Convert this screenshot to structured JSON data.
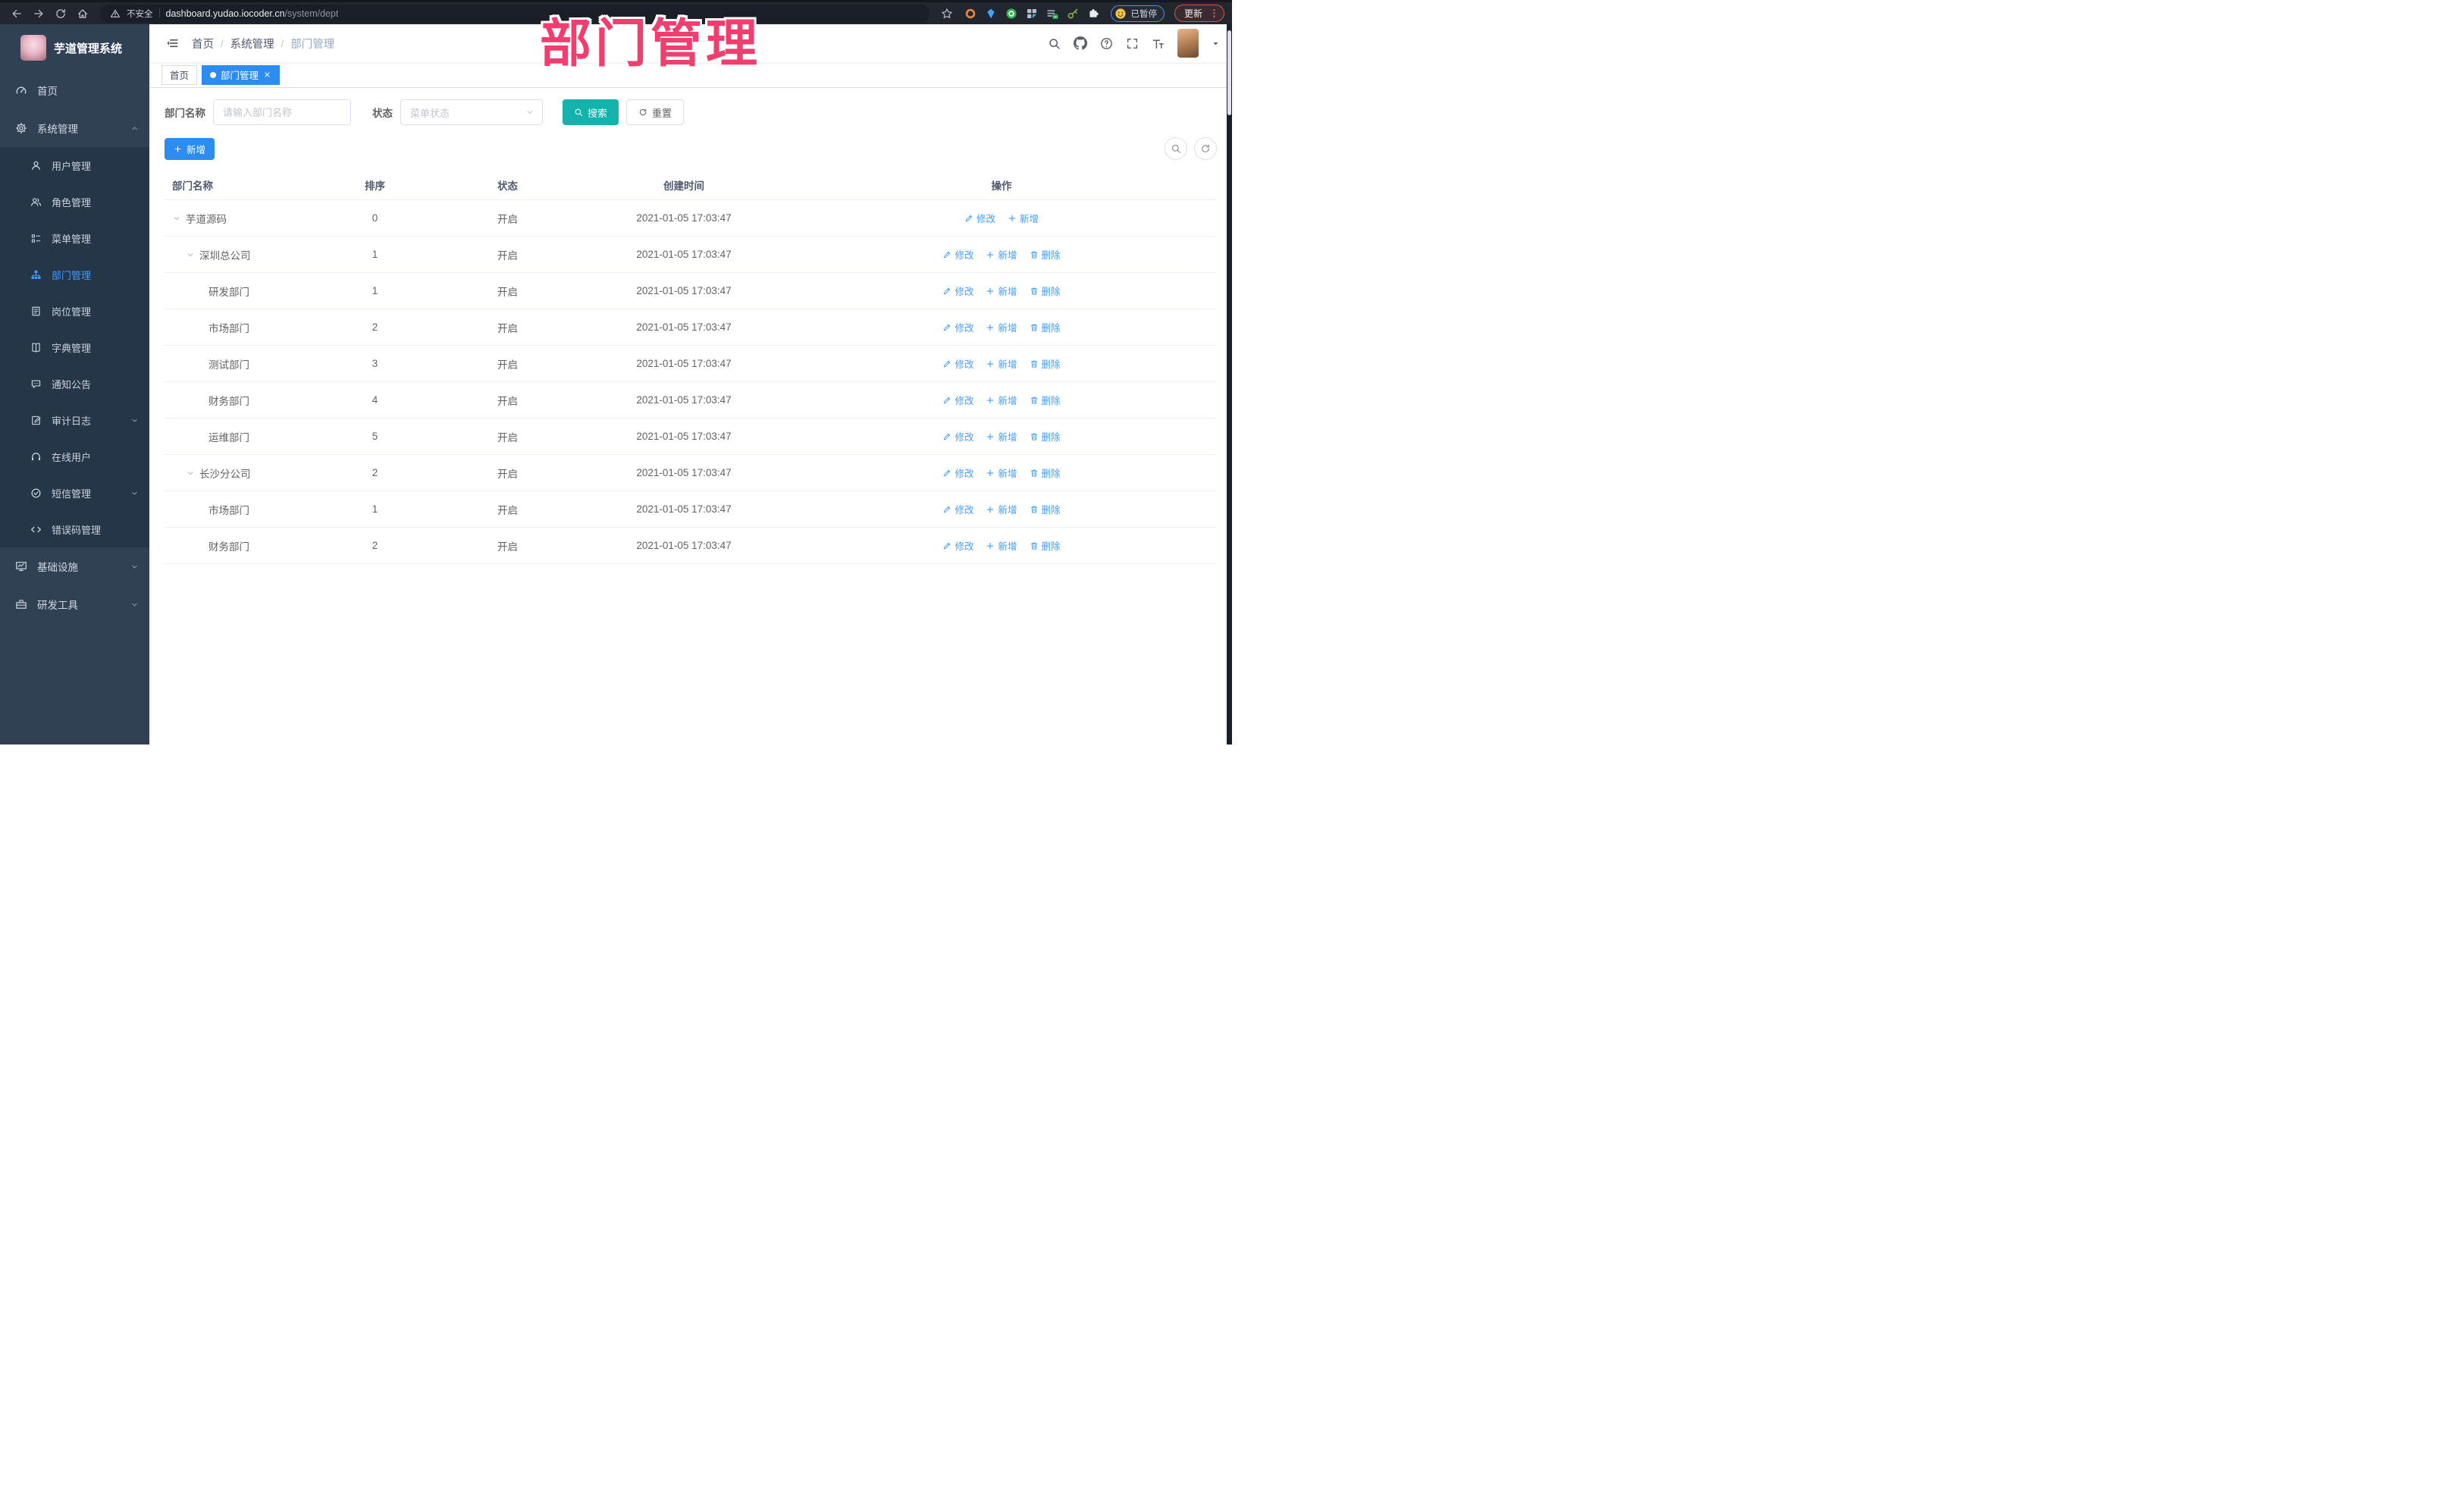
{
  "browser": {
    "security_label": "不安全",
    "url_host": "dashboard.yudao.iocoder.cn",
    "url_path": "/system/dept",
    "paused_label": "已暂停",
    "update_label": "更新",
    "nav_icons": [
      "back-icon",
      "forward-icon",
      "reload-icon",
      "home-icon"
    ],
    "extension_icons": [
      "bookmark-star-icon",
      "ext-shield-icon",
      "ext-gem-icon",
      "ext-check-icon",
      "ext-grid-icon",
      "ext-proxy-icon",
      "ext-key-icon",
      "ext-puzzle-icon"
    ]
  },
  "annotation": {
    "text": "部门管理",
    "color": "#f23e6e"
  },
  "sidebar": {
    "title": "芋道管理系统",
    "items": [
      {
        "key": "home",
        "label": "首页",
        "icon": "dashboard"
      },
      {
        "key": "system",
        "label": "系统管理",
        "icon": "gear",
        "expanded": true,
        "children": [
          {
            "key": "user",
            "label": "用户管理",
            "icon": "user"
          },
          {
            "key": "role",
            "label": "角色管理",
            "icon": "users"
          },
          {
            "key": "menu",
            "label": "菜单管理",
            "icon": "menu-tree"
          },
          {
            "key": "dept",
            "label": "部门管理",
            "icon": "org-tree",
            "active": true
          },
          {
            "key": "post",
            "label": "岗位管理",
            "icon": "badge"
          },
          {
            "key": "dict",
            "label": "字典管理",
            "icon": "book"
          },
          {
            "key": "notice",
            "label": "通知公告",
            "icon": "announce"
          },
          {
            "key": "audit-log",
            "label": "审计日志",
            "icon": "audit",
            "expandable": true
          },
          {
            "key": "online-user",
            "label": "在线用户",
            "icon": "headset"
          },
          {
            "key": "sms",
            "label": "短信管理",
            "icon": "sms",
            "expandable": true
          },
          {
            "key": "error-code",
            "label": "错误码管理",
            "icon": "code"
          }
        ]
      },
      {
        "key": "infra",
        "label": "基础设施",
        "icon": "infra",
        "expandable": true
      },
      {
        "key": "dev-tools",
        "label": "研发工具",
        "icon": "tools",
        "expandable": true
      }
    ]
  },
  "header": {
    "breadcrumb": [
      "首页",
      "系统管理",
      "部门管理"
    ],
    "icons": [
      "search-icon",
      "github-icon",
      "help-icon",
      "fullscreen-icon",
      "font-size-icon",
      "avatar",
      "chevron-down-icon"
    ]
  },
  "tabs": [
    {
      "key": "home",
      "label": "首页"
    },
    {
      "key": "dept",
      "label": "部门管理",
      "active": true,
      "closable": true
    }
  ],
  "filters": {
    "name_label": "部门名称",
    "name_placeholder": "请输入部门名称",
    "status_label": "状态",
    "status_placeholder": "菜单状态",
    "search_label": "搜索",
    "reset_label": "重置"
  },
  "toolbar": {
    "add_label": "新增"
  },
  "table": {
    "columns": [
      "部门名称",
      "排序",
      "状态",
      "创建时间",
      "操作"
    ],
    "action_labels": {
      "edit": "修改",
      "add": "新增",
      "delete": "删除"
    },
    "rows": [
      {
        "name": "芋道源码",
        "level": 0,
        "expanded": true,
        "sort": "0",
        "status": "开启",
        "created": "2021-01-05 17:03:47",
        "actions": [
          "edit",
          "add"
        ]
      },
      {
        "name": "深圳总公司",
        "level": 1,
        "expanded": true,
        "sort": "1",
        "status": "开启",
        "created": "2021-01-05 17:03:47",
        "actions": [
          "edit",
          "add",
          "delete"
        ]
      },
      {
        "name": "研发部门",
        "level": 2,
        "expanded": false,
        "sort": "1",
        "status": "开启",
        "created": "2021-01-05 17:03:47",
        "actions": [
          "edit",
          "add",
          "delete"
        ]
      },
      {
        "name": "市场部门",
        "level": 2,
        "expanded": false,
        "sort": "2",
        "status": "开启",
        "created": "2021-01-05 17:03:47",
        "actions": [
          "edit",
          "add",
          "delete"
        ]
      },
      {
        "name": "测试部门",
        "level": 2,
        "expanded": false,
        "sort": "3",
        "status": "开启",
        "created": "2021-01-05 17:03:47",
        "actions": [
          "edit",
          "add",
          "delete"
        ]
      },
      {
        "name": "财务部门",
        "level": 2,
        "expanded": false,
        "sort": "4",
        "status": "开启",
        "created": "2021-01-05 17:03:47",
        "actions": [
          "edit",
          "add",
          "delete"
        ]
      },
      {
        "name": "运维部门",
        "level": 2,
        "expanded": false,
        "sort": "5",
        "status": "开启",
        "created": "2021-01-05 17:03:47",
        "actions": [
          "edit",
          "add",
          "delete"
        ]
      },
      {
        "name": "长沙分公司",
        "level": 1,
        "expanded": true,
        "sort": "2",
        "status": "开启",
        "created": "2021-01-05 17:03:47",
        "actions": [
          "edit",
          "add",
          "delete"
        ]
      },
      {
        "name": "市场部门",
        "level": 2,
        "expanded": false,
        "sort": "1",
        "status": "开启",
        "created": "2021-01-05 17:03:47",
        "actions": [
          "edit",
          "add",
          "delete"
        ]
      },
      {
        "name": "财务部门",
        "level": 2,
        "expanded": false,
        "sort": "2",
        "status": "开启",
        "created": "2021-01-05 17:03:47",
        "actions": [
          "edit",
          "add",
          "delete"
        ]
      }
    ]
  },
  "colors": {
    "primary": "#409eff",
    "active_tab": "#2d8cf0",
    "search_button": "#16b0ad",
    "sidebar_bg": "#304156",
    "submenu_bg": "#253649",
    "annotation": "#f23e6e"
  }
}
